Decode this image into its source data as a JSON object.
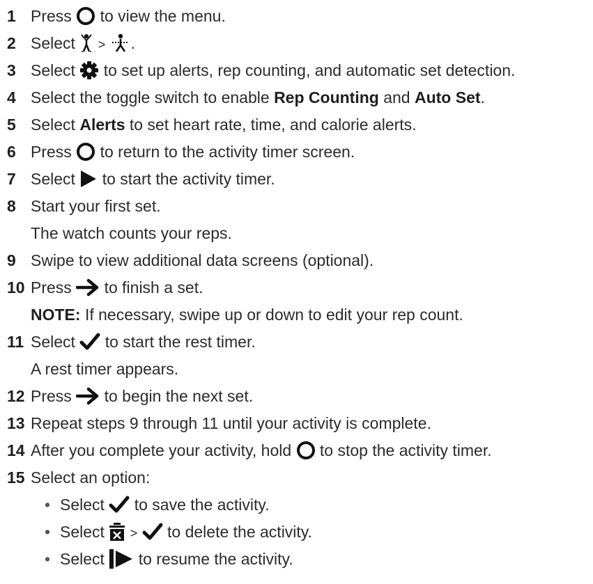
{
  "steps": [
    {
      "num": "1",
      "a": "Press",
      "b": "to view the menu."
    },
    {
      "num": "2",
      "a": "Select",
      "sep": ">",
      "end": "."
    },
    {
      "num": "3",
      "a": "Select",
      "b": "to set up alerts, rep counting, and automatic set detection."
    },
    {
      "num": "4",
      "a": "Select the toggle switch to enable",
      "bold1": "Rep Counting",
      "mid": "and",
      "bold2": "Auto Set",
      "end": "."
    },
    {
      "num": "5",
      "a": "Select",
      "bold1": "Alerts",
      "b": "to set heart rate, time, and calorie alerts."
    },
    {
      "num": "6",
      "a": "Press",
      "b": "to return to the activity timer screen."
    },
    {
      "num": "7",
      "a": "Select",
      "b": "to start the activity timer."
    },
    {
      "num": "8",
      "a": "Start your first set.",
      "cont": "The watch counts your reps."
    },
    {
      "num": "9",
      "a": "Swipe to view additional data screens (optional)."
    },
    {
      "num": "10",
      "a": "Press",
      "b": "to finish a set.",
      "note_label": "NOTE:",
      "note": "If necessary, swipe up or down to edit your rep count."
    },
    {
      "num": "11",
      "a": "Select",
      "b": "to start the rest timer.",
      "cont": "A rest timer appears."
    },
    {
      "num": "12",
      "a": "Press",
      "b": "to begin the next set."
    },
    {
      "num": "13",
      "a": "Repeat steps 9 through 11 until your activity is complete."
    },
    {
      "num": "14",
      "a": "After you complete your activity, hold",
      "b": "to stop the activity timer."
    },
    {
      "num": "15",
      "a": "Select an option:"
    }
  ],
  "bullets": [
    {
      "dot": "•",
      "a": "Select",
      "b": "to save the activity."
    },
    {
      "dot": "•",
      "a": "Select",
      "sep": ">",
      "b": "to delete the activity."
    },
    {
      "dot": "•",
      "a": "Select",
      "b": "to resume the activity."
    }
  ]
}
